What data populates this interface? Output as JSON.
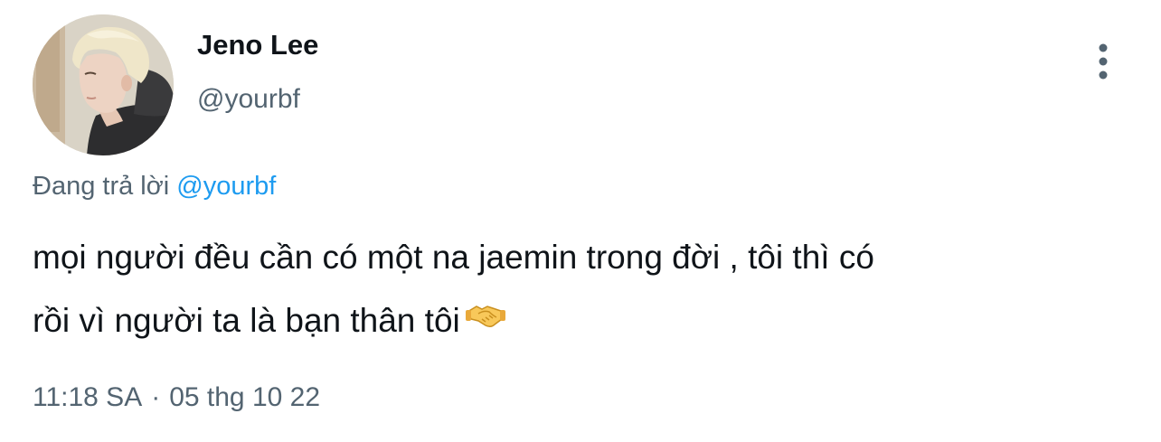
{
  "author": {
    "display_name": "Jeno Lee",
    "handle": "@yourbf"
  },
  "reply_context": {
    "prefix": "Đang trả lời",
    "mention": "@yourbf"
  },
  "tweet": {
    "text_line_1": "mọi người đều cần có một na jaemin trong đời , tôi thì có",
    "text_line_2": "rồi vì người ta là bạn thân tôi",
    "emoji": "handshake-emoji"
  },
  "meta": {
    "time": "11:18 SA",
    "separator": "·",
    "date": "05 thg 10 22"
  },
  "icons": {
    "more": "more-vertical-icon"
  },
  "colors": {
    "text": "#0f1419",
    "secondary": "#536471",
    "accent": "#1d9bf0"
  }
}
